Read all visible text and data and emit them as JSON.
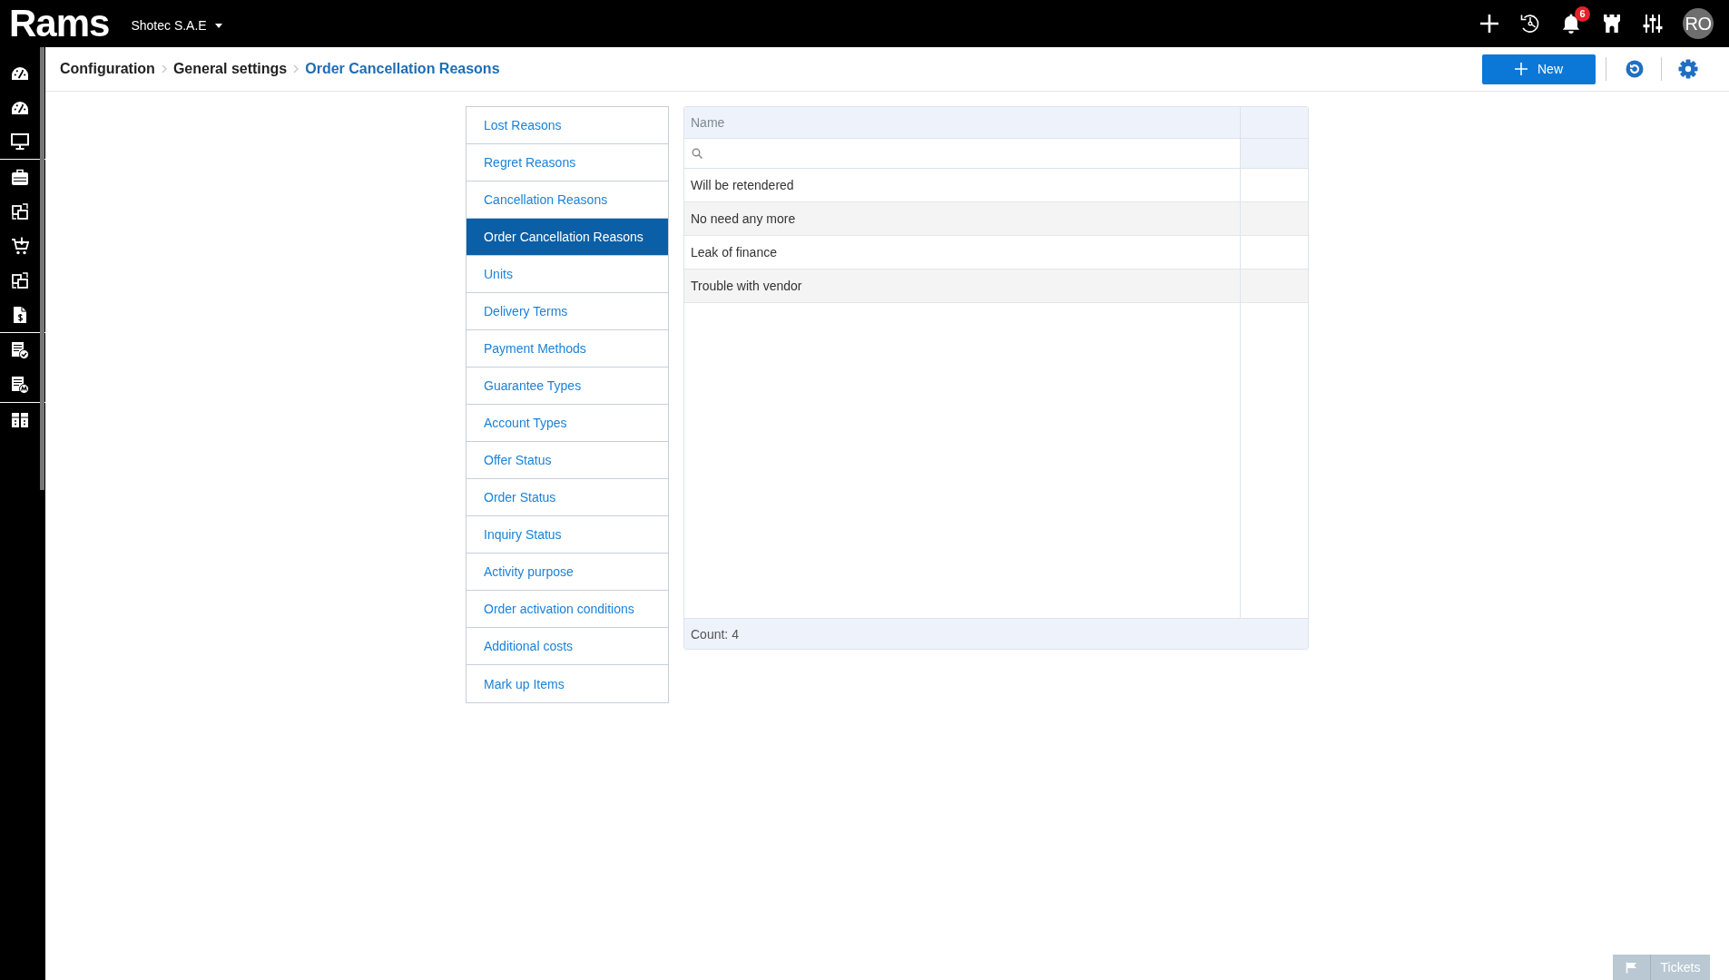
{
  "top_bar": {
    "logo": "Rams",
    "company": "Shotec S.A.E",
    "notifications": "6",
    "avatar": "RO"
  },
  "breadcrumb": [
    {
      "label": "Configuration",
      "current": false
    },
    {
      "label": "General settings",
      "current": false
    },
    {
      "label": "Order Cancellation Reasons",
      "current": true
    }
  ],
  "toolbar": {
    "new_button": "New"
  },
  "settings_list": [
    {
      "label": "Lost Reasons",
      "selected": false
    },
    {
      "label": "Regret Reasons",
      "selected": false
    },
    {
      "label": "Cancellation Reasons",
      "selected": false
    },
    {
      "label": "Order Cancellation Reasons",
      "selected": true
    },
    {
      "label": "Units",
      "selected": false
    },
    {
      "label": "Delivery Terms",
      "selected": false
    },
    {
      "label": "Payment Methods",
      "selected": false
    },
    {
      "label": "Guarantee Types",
      "selected": false
    },
    {
      "label": "Account Types",
      "selected": false
    },
    {
      "label": "Offer Status",
      "selected": false
    },
    {
      "label": "Order Status",
      "selected": false
    },
    {
      "label": "Inquiry Status",
      "selected": false
    },
    {
      "label": "Activity purpose",
      "selected": false
    },
    {
      "label": "Order activation conditions",
      "selected": false
    },
    {
      "label": "Additional costs",
      "selected": false
    },
    {
      "label": "Mark up Items",
      "selected": false
    }
  ],
  "table": {
    "columns": [
      "Name"
    ],
    "rows": [
      {
        "name": "Will be retendered"
      },
      {
        "name": "No need any more"
      },
      {
        "name": "Leak of finance"
      },
      {
        "name": "Trouble with vendor"
      }
    ],
    "footer": "Count: 4"
  },
  "tickets_button": "Tickets"
}
